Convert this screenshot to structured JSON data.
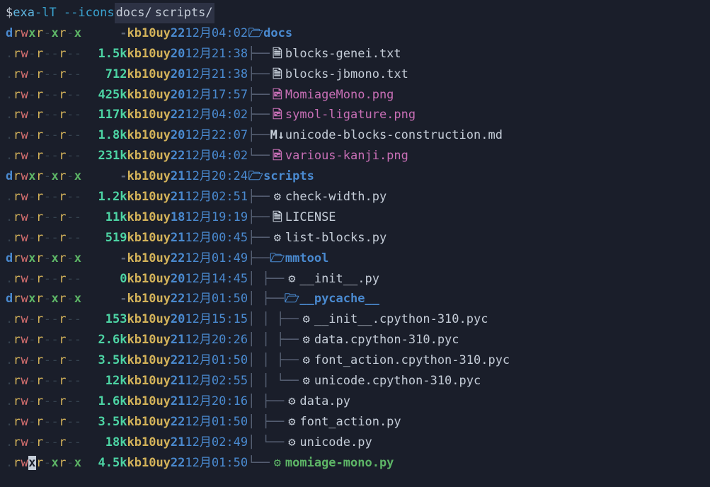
{
  "prompt": {
    "dollar": "$",
    "cmd": "exa",
    "flags": "-lT --icons",
    "arg1": "docs/",
    "arg2": "scripts/"
  },
  "icons": {
    "folder_closed": "🗀",
    "folder_open": "🗁",
    "txt": "🗎",
    "img": "🖻",
    "md": "M↓",
    "py": "⚙"
  },
  "rows": [
    {
      "perm": "drwxr-xr-x",
      "size": "-",
      "owner": "kb10uy",
      "day": "22",
      "mon": "12月",
      "time": "04:02",
      "tree": "",
      "icon": "folder_open",
      "iclass": "icon-folder",
      "name": "docs",
      "nclass": "fn-dir"
    },
    {
      "perm": ".rw-r--r--",
      "size": "1.5k",
      "owner": "kb10uy",
      "day": "20",
      "mon": "12月",
      "time": "21:38",
      "tree": "├── ",
      "icon": "txt",
      "iclass": "icon-txt",
      "name": "blocks-genei.txt",
      "nclass": "fn-txt"
    },
    {
      "perm": ".rw-r--r--",
      "size": "712",
      "owner": "kb10uy",
      "day": "20",
      "mon": "12月",
      "time": "21:38",
      "tree": "├── ",
      "icon": "txt",
      "iclass": "icon-txt",
      "name": "blocks-jbmono.txt",
      "nclass": "fn-txt"
    },
    {
      "perm": ".rw-r--r--",
      "size": "425k",
      "owner": "kb10uy",
      "day": "20",
      "mon": "12月",
      "time": "17:57",
      "tree": "├── ",
      "icon": "img",
      "iclass": "icon-img",
      "name": "MomiageMono.png",
      "nclass": "fn-img"
    },
    {
      "perm": ".rw-r--r--",
      "size": "117k",
      "owner": "kb10uy",
      "day": "22",
      "mon": "12月",
      "time": "04:02",
      "tree": "├── ",
      "icon": "img",
      "iclass": "icon-img",
      "name": "symol-ligature.png",
      "nclass": "fn-img"
    },
    {
      "perm": ".rw-r--r--",
      "size": "1.8k",
      "owner": "kb10uy",
      "day": "20",
      "mon": "12月",
      "time": "22:07",
      "tree": "├── ",
      "icon": "md",
      "iclass": "icon-md",
      "name": "unicode-blocks-construction.md",
      "nclass": "fn-md"
    },
    {
      "perm": ".rw-r--r--",
      "size": "231k",
      "owner": "kb10uy",
      "day": "22",
      "mon": "12月",
      "time": "04:02",
      "tree": "└── ",
      "icon": "img",
      "iclass": "icon-img",
      "name": "various-kanji.png",
      "nclass": "fn-img"
    },
    {
      "perm": "drwxr-xr-x",
      "size": "-",
      "owner": "kb10uy",
      "day": "21",
      "mon": "12月",
      "time": "20:24",
      "tree": "",
      "icon": "folder_open",
      "iclass": "icon-folder",
      "name": "scripts",
      "nclass": "fn-dir"
    },
    {
      "perm": ".rw-r--r--",
      "size": "1.2k",
      "owner": "kb10uy",
      "day": "21",
      "mon": "12月",
      "time": "02:51",
      "tree": "├── ",
      "icon": "py",
      "iclass": "icon-py",
      "name": "check-width.py",
      "nclass": "fn-py"
    },
    {
      "perm": ".rw-r--r--",
      "size": "11k",
      "owner": "kb10uy",
      "day": "18",
      "mon": "12月",
      "time": "19:19",
      "tree": "├── ",
      "icon": "txt",
      "iclass": "icon-txt",
      "name": "LICENSE",
      "nclass": "fn-txt"
    },
    {
      "perm": ".rw-r--r--",
      "size": "519",
      "owner": "kb10uy",
      "day": "21",
      "mon": "12月",
      "time": "00:45",
      "tree": "├── ",
      "icon": "py",
      "iclass": "icon-py",
      "name": "list-blocks.py",
      "nclass": "fn-py"
    },
    {
      "perm": "drwxr-xr-x",
      "size": "-",
      "owner": "kb10uy",
      "day": "22",
      "mon": "12月",
      "time": "01:49",
      "tree": "├── ",
      "icon": "folder_open",
      "iclass": "icon-folder",
      "name": "mmtool",
      "nclass": "fn-dir"
    },
    {
      "perm": ".rw-r--r--",
      "size": "0",
      "owner": "kb10uy",
      "day": "20",
      "mon": "12月",
      "time": "14:45",
      "tree": "│   ├── ",
      "icon": "py",
      "iclass": "icon-py",
      "name": "__init__.py",
      "nclass": "fn-py"
    },
    {
      "perm": "drwxr-xr-x",
      "size": "-",
      "owner": "kb10uy",
      "day": "22",
      "mon": "12月",
      "time": "01:50",
      "tree": "│   ├── ",
      "icon": "folder_open",
      "iclass": "icon-folder",
      "name": "__pycache__",
      "nclass": "fn-dir"
    },
    {
      "perm": ".rw-r--r--",
      "size": "153",
      "owner": "kb10uy",
      "day": "20",
      "mon": "12月",
      "time": "15:15",
      "tree": "│   │   ├── ",
      "icon": "py",
      "iclass": "icon-py",
      "name": "__init__.cpython-310.pyc",
      "nclass": "fn-py"
    },
    {
      "perm": ".rw-r--r--",
      "size": "2.6k",
      "owner": "kb10uy",
      "day": "21",
      "mon": "12月",
      "time": "20:26",
      "tree": "│   │   ├── ",
      "icon": "py",
      "iclass": "icon-py",
      "name": "data.cpython-310.pyc",
      "nclass": "fn-py"
    },
    {
      "perm": ".rw-r--r--",
      "size": "3.5k",
      "owner": "kb10uy",
      "day": "22",
      "mon": "12月",
      "time": "01:50",
      "tree": "│   │   ├── ",
      "icon": "py",
      "iclass": "icon-py",
      "name": "font_action.cpython-310.pyc",
      "nclass": "fn-py"
    },
    {
      "perm": ".rw-r--r--",
      "size": "12k",
      "owner": "kb10uy",
      "day": "21",
      "mon": "12月",
      "time": "02:55",
      "tree": "│   │   └── ",
      "icon": "py",
      "iclass": "icon-py",
      "name": "unicode.cpython-310.pyc",
      "nclass": "fn-py"
    },
    {
      "perm": ".rw-r--r--",
      "size": "1.6k",
      "owner": "kb10uy",
      "day": "21",
      "mon": "12月",
      "time": "20:16",
      "tree": "│   ├── ",
      "icon": "py",
      "iclass": "icon-py",
      "name": "data.py",
      "nclass": "fn-py"
    },
    {
      "perm": ".rw-r--r--",
      "size": "3.5k",
      "owner": "kb10uy",
      "day": "22",
      "mon": "12月",
      "time": "01:50",
      "tree": "│   ├── ",
      "icon": "py",
      "iclass": "icon-py",
      "name": "font_action.py",
      "nclass": "fn-py"
    },
    {
      "perm": ".rw-r--r--",
      "size": "18k",
      "owner": "kb10uy",
      "day": "21",
      "mon": "12月",
      "time": "02:49",
      "tree": "│   └── ",
      "icon": "py",
      "iclass": "icon-py",
      "name": "unicode.py",
      "nclass": "fn-py"
    },
    {
      "perm": ".rwxr-xr-x",
      "size": "4.5k",
      "owner": "kb10uy",
      "day": "22",
      "mon": "12月",
      "time": "01:50",
      "tree": "└── ",
      "icon": "py",
      "iclass": "icon-py-green",
      "name": "momiage-mono.py",
      "nclass": "fn-exec",
      "cursor": true
    }
  ]
}
